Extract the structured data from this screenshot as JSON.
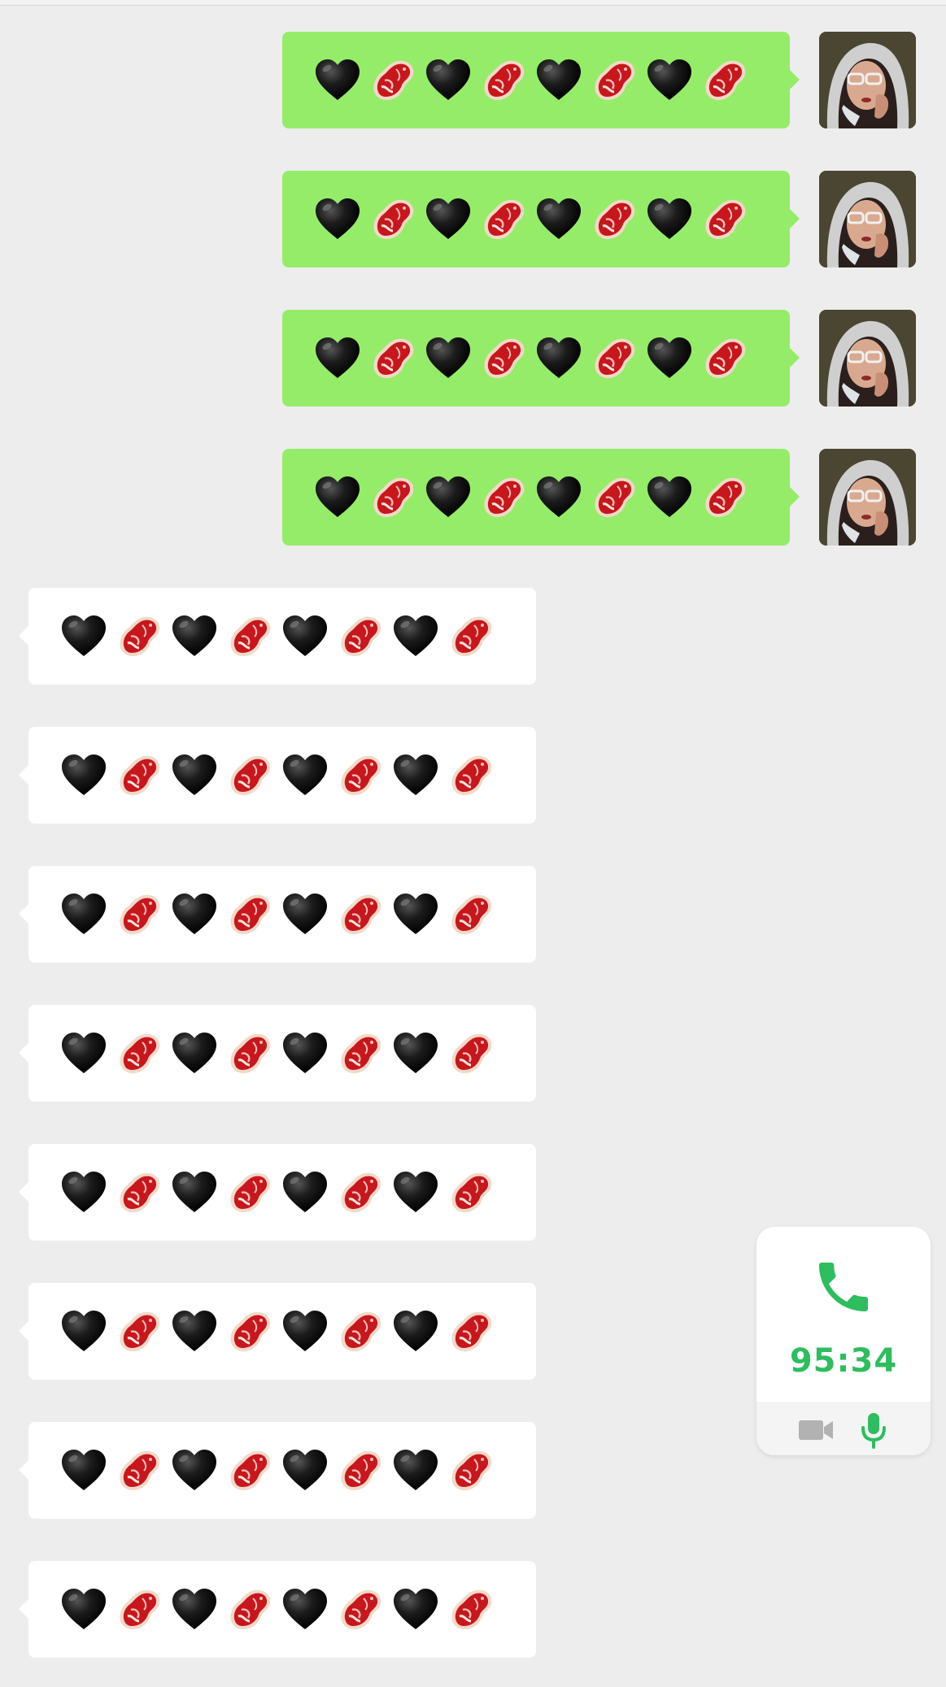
{
  "screen": {
    "background": "#ededed"
  },
  "messages": [
    {
      "direction": "outgoing",
      "content": "🖤🥩🖤🥩🖤🥩🖤🥩",
      "avatar": "user-avatar"
    },
    {
      "direction": "outgoing",
      "content": "🖤🥩🖤🥩🖤🥩🖤🥩",
      "avatar": "user-avatar"
    },
    {
      "direction": "outgoing",
      "content": "🖤🥩🖤🥩🖤🥩🖤🥩",
      "avatar": "user-avatar"
    },
    {
      "direction": "outgoing",
      "content": "🖤🥩🖤🥩🖤🥩🖤🥩",
      "avatar": "user-avatar"
    },
    {
      "direction": "incoming",
      "content": "🖤🥩🖤🥩🖤🥩🖤🥩"
    },
    {
      "direction": "incoming",
      "content": "🖤🥩🖤🥩🖤🥩🖤🥩"
    },
    {
      "direction": "incoming",
      "content": "🖤🥩🖤🥩🖤🥩🖤🥩"
    },
    {
      "direction": "incoming",
      "content": "🖤🥩🖤🥩🖤🥩🖤🥩"
    },
    {
      "direction": "incoming",
      "content": "🖤🥩🖤🥩🖤🥩🖤🥩"
    },
    {
      "direction": "incoming",
      "content": "🖤🥩🖤🥩🖤🥩🖤🥩"
    },
    {
      "direction": "incoming",
      "content": "🖤🥩🖤🥩🖤🥩🖤🥩"
    },
    {
      "direction": "incoming",
      "content": "🖤🥩🖤🥩🖤🥩🖤🥩"
    }
  ],
  "colors": {
    "outgoing_bubble": "#95ec69",
    "incoming_bubble": "#ffffff",
    "call_accent": "#2ebd5f"
  },
  "call_widget": {
    "icon": "phone-icon",
    "timer": "95:34",
    "controls": [
      {
        "icon": "video-camera-icon",
        "state": "off"
      },
      {
        "icon": "microphone-icon",
        "state": "on"
      }
    ]
  }
}
